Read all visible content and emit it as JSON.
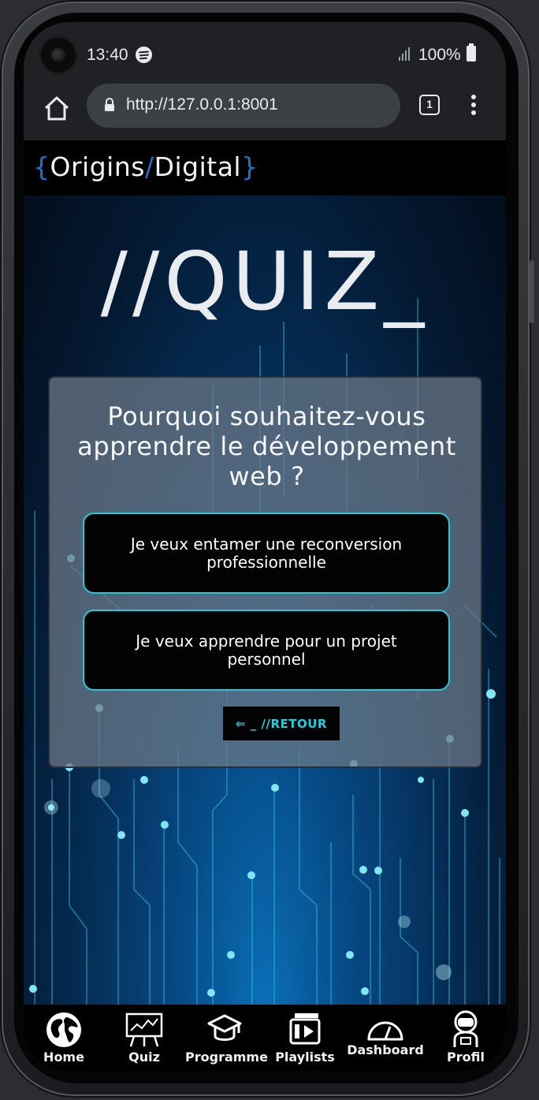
{
  "status_bar": {
    "time": "13:40",
    "battery": "100%"
  },
  "browser": {
    "url": "http://127.0.0.1:8001",
    "tab_count": "1"
  },
  "site": {
    "logo_open": "{",
    "logo_word1": "Origins",
    "logo_slash": "/",
    "logo_word2": "Digital",
    "logo_close": "}"
  },
  "quiz": {
    "title": "//QUIZ_",
    "question": "Pourquoi souhaitez-vous apprendre le développement web ?",
    "answers": [
      "Je veux entamer une reconversion professionnelle",
      "Je veux apprendre pour un projet personnel"
    ],
    "back_label": "⇐ _ //RETOUR"
  },
  "nav": {
    "items": [
      {
        "label": "Home",
        "icon": "globe-icon"
      },
      {
        "label": "Quiz",
        "icon": "presentation-chart-icon"
      },
      {
        "label": "Programme",
        "icon": "graduation-cap-icon"
      },
      {
        "label": "Playlists",
        "icon": "video-playlist-icon"
      },
      {
        "label": "Dashboard",
        "icon": "gauge-icon"
      },
      {
        "label": "Profil",
        "icon": "astronaut-icon"
      }
    ]
  }
}
